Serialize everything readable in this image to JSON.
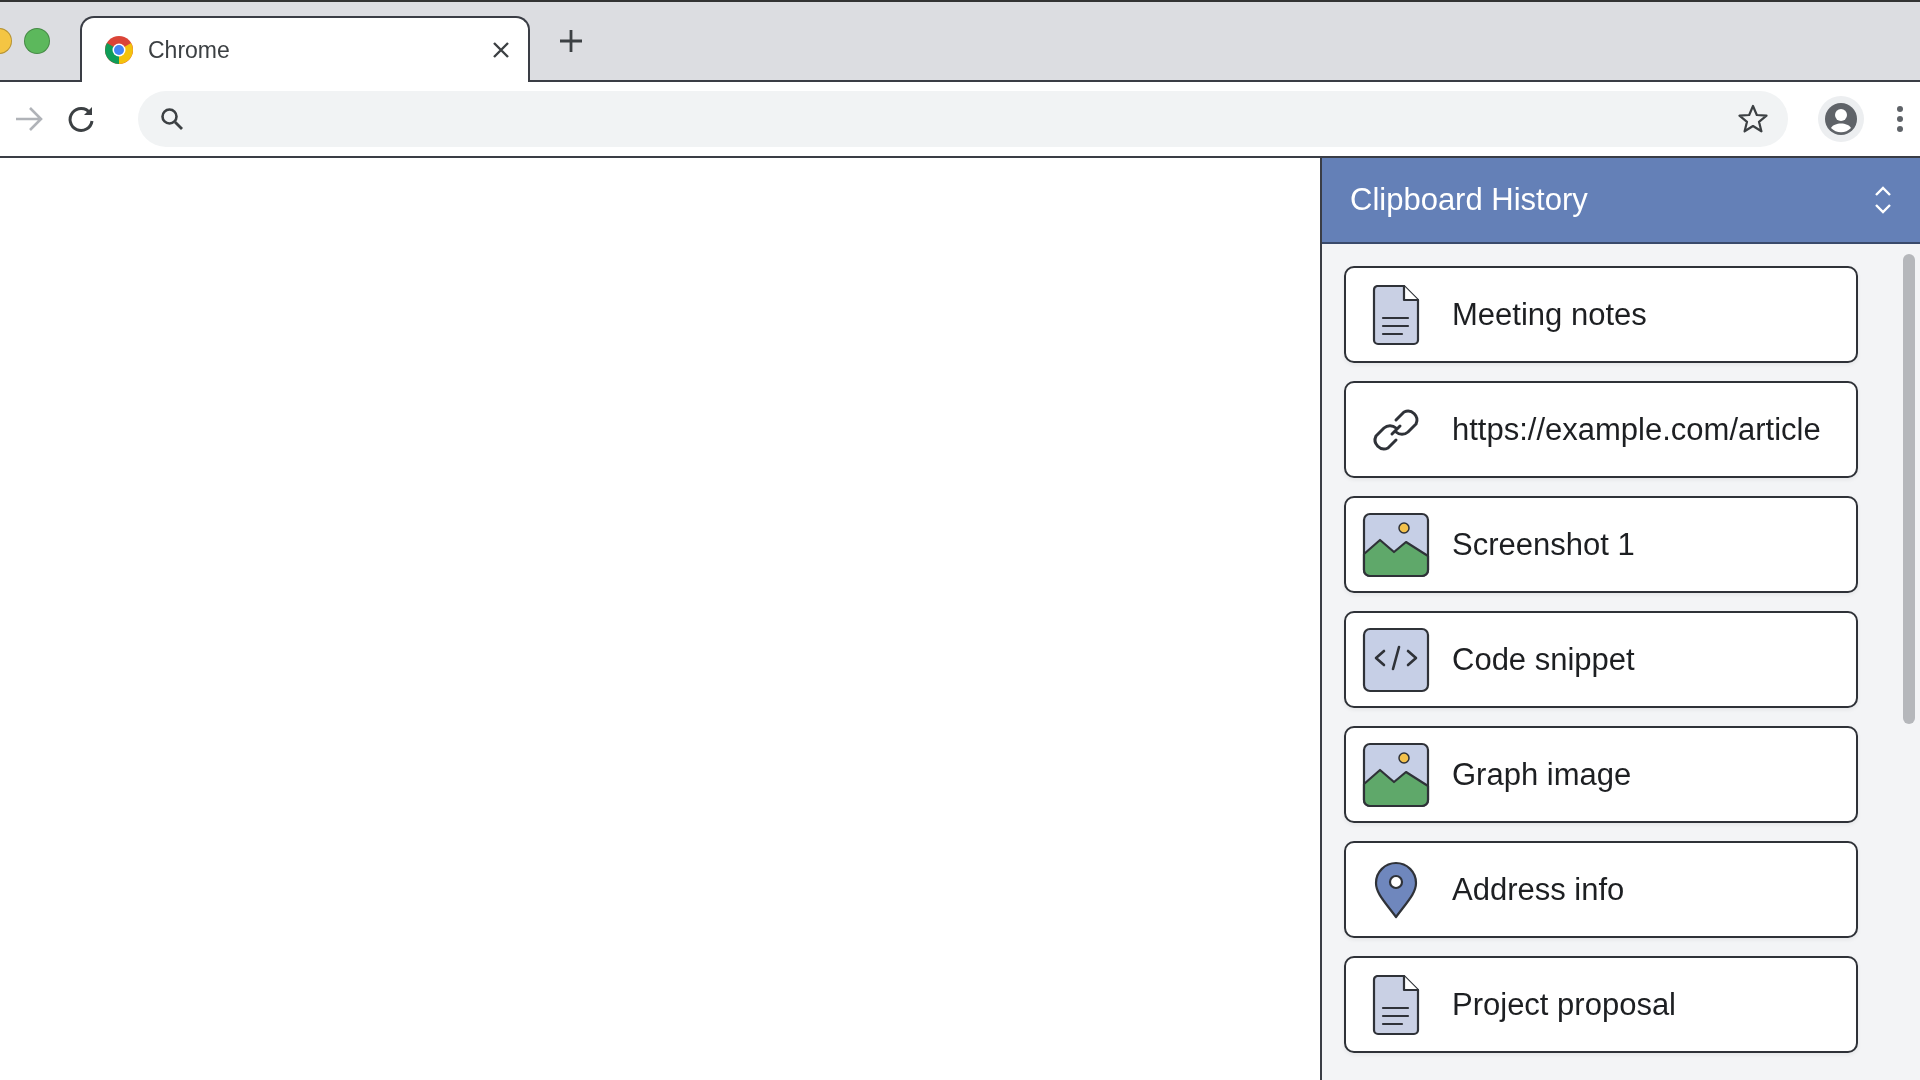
{
  "window_controls": [
    {
      "color": "#f4c543"
    },
    {
      "color": "#5cb85c"
    }
  ],
  "tabs": [
    {
      "title": "Chrome",
      "selected": true
    }
  ],
  "panel": {
    "title": "Clipboard History",
    "items": [
      {
        "kind": "document",
        "label": "Meeting notes"
      },
      {
        "kind": "link",
        "label": "https://example.com/article"
      },
      {
        "kind": "image",
        "label": "Screenshot 1"
      },
      {
        "kind": "code",
        "label": "Code snippet"
      },
      {
        "kind": "image",
        "label": "Graph image"
      },
      {
        "kind": "location",
        "label": "Address info"
      },
      {
        "kind": "document",
        "label": "Project proposal"
      }
    ]
  }
}
